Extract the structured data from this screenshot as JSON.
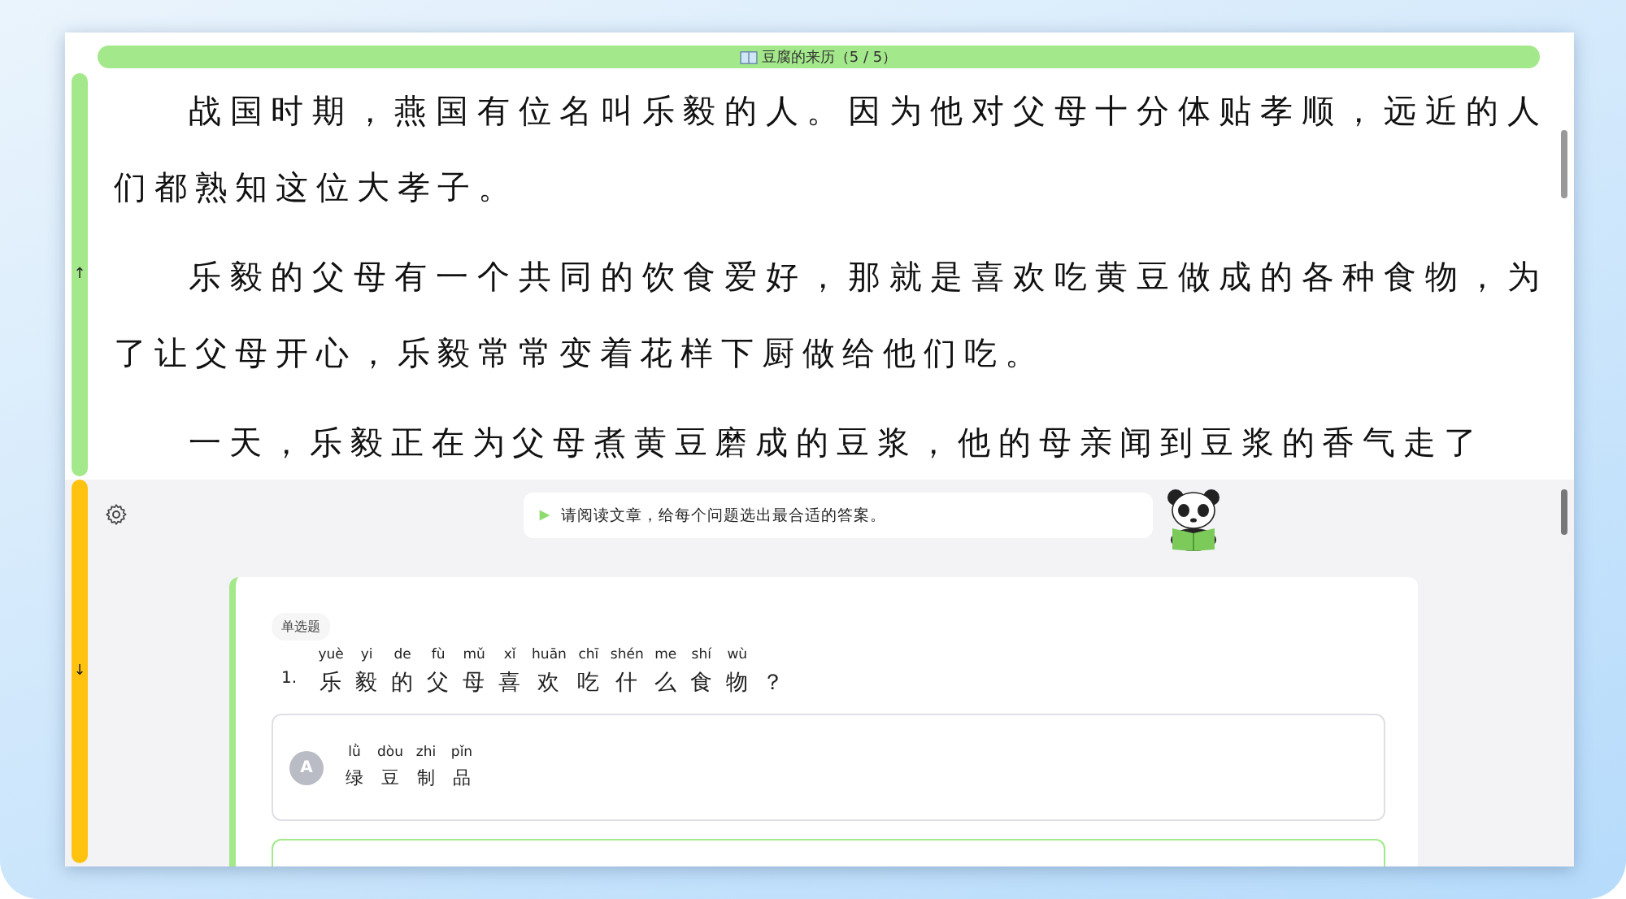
{
  "title_bar": {
    "title": "豆腐的来历（5 / 5）"
  },
  "side_tabs": [
    {
      "arrow": "↑",
      "color": "#a3e88a"
    },
    {
      "arrow": "↓",
      "color": "#ffc20e"
    }
  ],
  "passage": {
    "paragraphs": [
      "战国时期，燕国有位名叫乐毅的人。因为他对父母十分体贴孝顺，远近的人们都熟知这位大孝子。",
      "乐毅的父母有一个共同的饮食爱好，那就是喜欢吃黄豆做成的各种食物，为了让父母开心，乐毅常常变着花样下厨做给他们吃。",
      "一天，乐毅正在为父母煮黄豆磨成的豆浆，他的母亲闻到豆浆的香气走了"
    ]
  },
  "instruction": {
    "text": "请阅读文章，给每个问题选出最合适的答案。"
  },
  "question": {
    "type_tag": "单选题",
    "number": "1.",
    "ruby": [
      {
        "pinyin": "yuè",
        "char": "乐"
      },
      {
        "pinyin": "yi",
        "char": "毅"
      },
      {
        "pinyin": "de",
        "char": "的"
      },
      {
        "pinyin": "fù",
        "char": "父"
      },
      {
        "pinyin": "mǔ",
        "char": "母"
      },
      {
        "pinyin": "xǐ",
        "char": "喜"
      },
      {
        "pinyin": "huān",
        "char": "欢"
      },
      {
        "pinyin": "chī",
        "char": "吃"
      },
      {
        "pinyin": "shén",
        "char": "什"
      },
      {
        "pinyin": "me",
        "char": "么"
      },
      {
        "pinyin": "shí",
        "char": "食"
      },
      {
        "pinyin": "wù",
        "char": "物"
      },
      {
        "char": "？"
      }
    ]
  },
  "options": [
    {
      "letter": "A",
      "selected": false,
      "ruby": [
        {
          "pinyin": "lǜ",
          "char": "绿"
        },
        {
          "pinyin": "dòu",
          "char": "豆"
        },
        {
          "pinyin": "zhi",
          "char": "制"
        },
        {
          "pinyin": "pǐn",
          "char": "品"
        }
      ]
    },
    {
      "selected": true
    }
  ]
}
